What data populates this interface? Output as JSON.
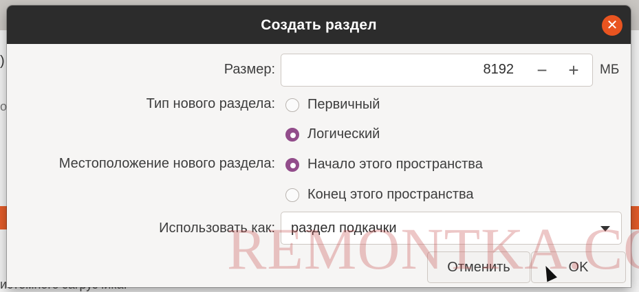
{
  "background": {
    "left_fragment_1": ")",
    "left_fragment_2": "о",
    "bottom_text": "истемного загрузчика."
  },
  "dialog": {
    "title": "Создать раздел",
    "close_icon": "close-icon"
  },
  "size": {
    "label": "Размер:",
    "value": "8192",
    "minus": "−",
    "plus": "+",
    "unit": "МБ"
  },
  "partition_type": {
    "label": "Тип нового раздела:",
    "options": [
      {
        "label": "Первичный",
        "checked": false
      },
      {
        "label": "Логический",
        "checked": true
      }
    ]
  },
  "location": {
    "label": "Местоположение нового раздела:",
    "options": [
      {
        "label": "Начало этого пространства",
        "checked": true
      },
      {
        "label": "Конец этого пространства",
        "checked": false
      }
    ]
  },
  "use_as": {
    "label": "Использовать как:",
    "value": "раздел подкачки"
  },
  "buttons": {
    "cancel": "Отменить",
    "ok": "OK"
  },
  "watermark": "REMONTKA.COM",
  "colors": {
    "accent_radio": "#924d8b",
    "close_button": "#e95420",
    "titlebar": "#2c2c2c"
  }
}
